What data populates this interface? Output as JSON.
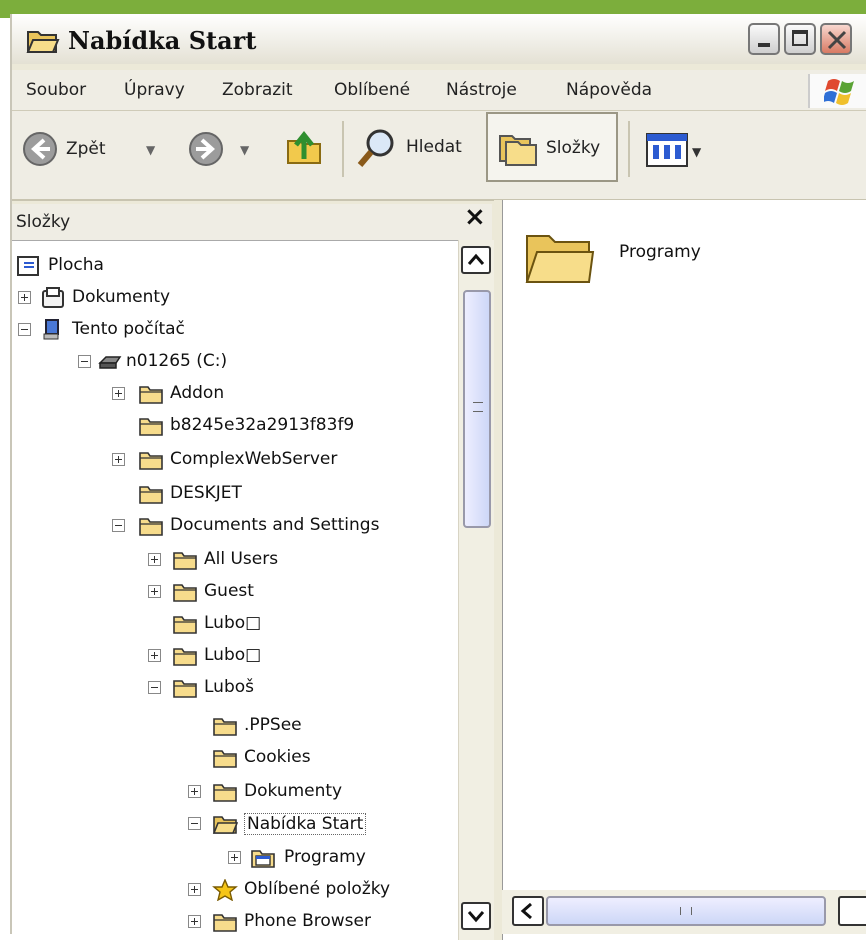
{
  "window": {
    "title": "Nabídka Start",
    "title_icon": "open-folder-icon"
  },
  "menu": [
    "Soubor",
    "Úpravy",
    "Zobrazit",
    "Oblíbené",
    "Nástroje",
    "Nápověda"
  ],
  "toolbar": {
    "back_label": "Zpět",
    "search_label": "Hledat",
    "folders_label": "Složky"
  },
  "folders_pane": {
    "title": "Složky",
    "close_label": "×"
  },
  "tree": [
    {
      "label": "Plocha",
      "icon": "desktop-icon"
    },
    {
      "label": "Dokumenty",
      "icon": "documents-icon"
    },
    {
      "label": "Tento počítač",
      "icon": "computer-icon"
    },
    {
      "label": "n01265 (C:)",
      "icon": "drive-icon"
    },
    {
      "label": "Addon",
      "icon": "folder-icon"
    },
    {
      "label": "b8245e32a2913f83f9",
      "icon": "folder-icon"
    },
    {
      "label": "ComplexWebServer",
      "icon": "folder-icon"
    },
    {
      "label": "DESKJET",
      "icon": "folder-icon"
    },
    {
      "label": "Documents and Settings",
      "icon": "folder-icon"
    },
    {
      "label": "All Users",
      "icon": "folder-icon"
    },
    {
      "label": "Guest",
      "icon": "folder-icon"
    },
    {
      "label": "Lubo□",
      "icon": "folder-icon"
    },
    {
      "label": "Lubo□",
      "icon": "folder-icon"
    },
    {
      "label": "Luboš",
      "icon": "folder-icon"
    },
    {
      "label": ".PPSee",
      "icon": "folder-icon"
    },
    {
      "label": "Cookies",
      "icon": "folder-icon"
    },
    {
      "label": "Dokumenty",
      "icon": "folder-icon"
    },
    {
      "label": "Nabídka Start",
      "icon": "open-folder-icon"
    },
    {
      "label": "Programy",
      "icon": "programs-folder-icon"
    },
    {
      "label": "Oblíbené položky",
      "icon": "favorites-star-icon"
    },
    {
      "label": "Phone Browser",
      "icon": "folder-icon"
    }
  ],
  "content": {
    "items": [
      {
        "label": "Programy",
        "icon": "large-folder-icon"
      }
    ]
  },
  "colors": {
    "accent_green": "#7cae3c",
    "chrome": "#ece9d8",
    "folder": "#f3d27a"
  }
}
